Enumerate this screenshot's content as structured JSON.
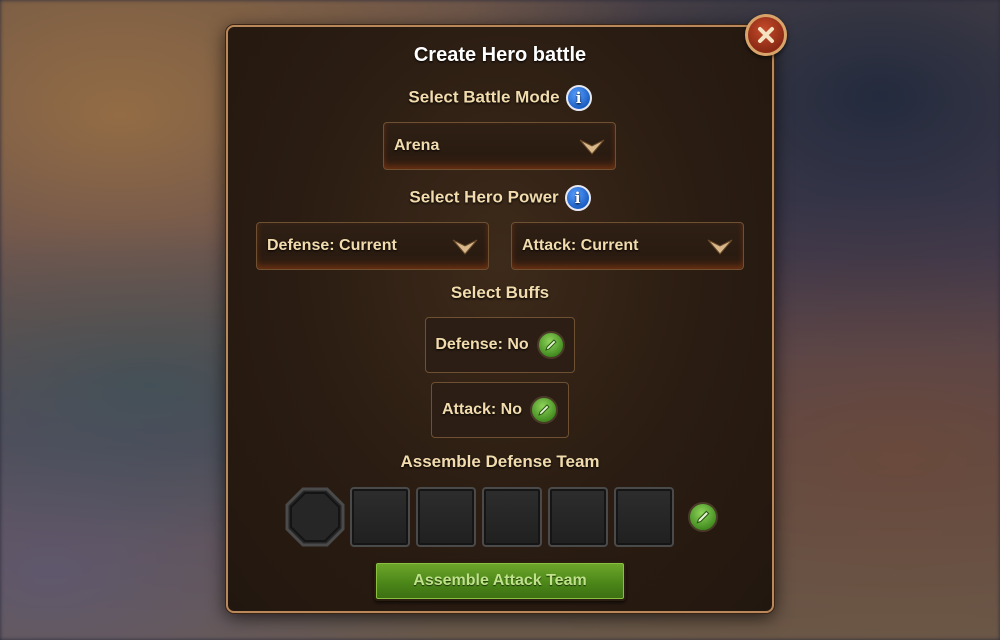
{
  "dialog": {
    "title": "Create Hero battle",
    "battle_mode_label": "Select Battle Mode",
    "battle_mode_value": "Arena",
    "hero_power_label": "Select Hero Power",
    "defense_power_value": "Defense: Current",
    "attack_power_value": "Attack: Current",
    "buffs_label": "Select Buffs",
    "defense_buff": "Defense: No",
    "attack_buff": "Attack: No",
    "defense_team_label": "Assemble Defense Team",
    "attack_team_button": "Assemble Attack Team",
    "info_glyph": "i"
  },
  "icons": {
    "close": "close-icon",
    "info": "info-icon",
    "chevron": "chevron-down-icon",
    "edit": "pencil-icon"
  },
  "colors": {
    "frame_border": "#b8875a",
    "label_text": "#f2dcae",
    "info_blue": "#1a5ec4",
    "edit_green": "#3f8a1e",
    "attack_button_green": "#4c8719"
  }
}
